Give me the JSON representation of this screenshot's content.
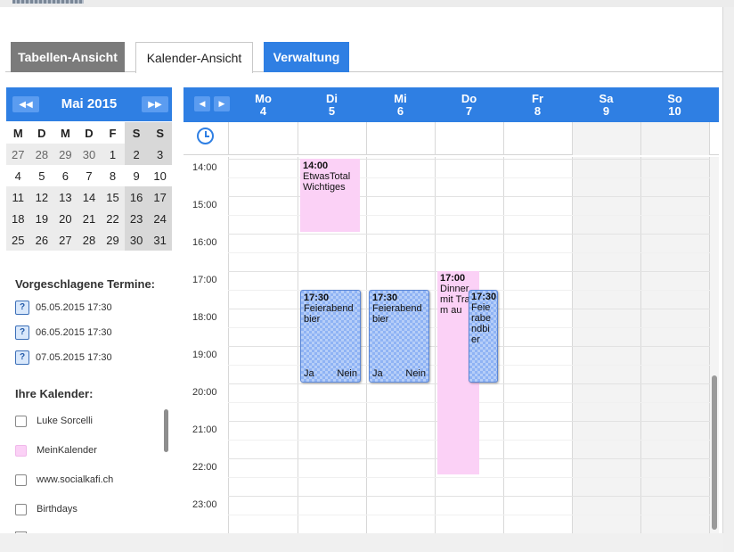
{
  "tabs": [
    {
      "label": "Tabellen-Ansicht"
    },
    {
      "label": "Kalender-Ansicht"
    },
    {
      "label": "Verwaltung"
    }
  ],
  "mini_calendar": {
    "title": "Mai 2015",
    "prev_icon": "double-left-arrow-icon",
    "next_icon": "double-right-arrow-icon",
    "weekdays": [
      "M",
      "D",
      "M",
      "D",
      "F",
      "S",
      "S"
    ],
    "weeks": [
      [
        "27",
        "28",
        "29",
        "30",
        "1",
        "2",
        "3"
      ],
      [
        "4",
        "5",
        "6",
        "7",
        "8",
        "9",
        "10"
      ],
      [
        "11",
        "12",
        "13",
        "14",
        "15",
        "16",
        "17"
      ],
      [
        "18",
        "19",
        "20",
        "21",
        "22",
        "23",
        "24"
      ],
      [
        "25",
        "26",
        "27",
        "28",
        "29",
        "30",
        "31"
      ]
    ]
  },
  "suggested": {
    "title": "Vorgeschlagene Termine:",
    "items": [
      {
        "icon": "?",
        "label": "05.05.2015 17:30"
      },
      {
        "icon": "?",
        "label": "06.05.2015 17:30"
      },
      {
        "icon": "?",
        "label": "07.05.2015 17:30"
      }
    ]
  },
  "calendars": {
    "title": "Ihre Kalender:",
    "items": [
      {
        "label": "Luke Sorcelli",
        "color": "#ffffff"
      },
      {
        "label": "MeinKalender",
        "color": "#fbd1f6"
      },
      {
        "label": "www.socialkafi.ch",
        "color": "#ffffff"
      },
      {
        "label": "Birthdays",
        "color": "#ffffff"
      }
    ]
  },
  "week": {
    "days": [
      {
        "name": "Mo",
        "num": "4"
      },
      {
        "name": "Di",
        "num": "5"
      },
      {
        "name": "Mi",
        "num": "6"
      },
      {
        "name": "Do",
        "num": "7"
      },
      {
        "name": "Fr",
        "num": "8"
      },
      {
        "name": "Sa",
        "num": "9"
      },
      {
        "name": "So",
        "num": "10"
      }
    ],
    "hours": [
      "14:00",
      "15:00",
      "16:00",
      "17:00",
      "18:00",
      "19:00",
      "20:00",
      "21:00",
      "22:00",
      "23:00"
    ]
  },
  "events": [
    {
      "time": "14:00",
      "title": "EtwasTotal Wichtiges"
    },
    {
      "time": "17:30",
      "title": "Feierabend bier",
      "yes": "Ja",
      "no": "Nein"
    },
    {
      "time": "17:30",
      "title": "Feierabend bier",
      "yes": "Ja",
      "no": "Nein"
    },
    {
      "time": "17:00",
      "title": "Dinner mit Traum au"
    },
    {
      "time": "17:30",
      "title": "Feie rabe ndbi er"
    }
  ],
  "colors": {
    "accent": "#2f7fe3",
    "tab_inactive": "#7b7b7b",
    "event_pink": "#fbd1f6",
    "event_blue": "#8fb3f4"
  }
}
